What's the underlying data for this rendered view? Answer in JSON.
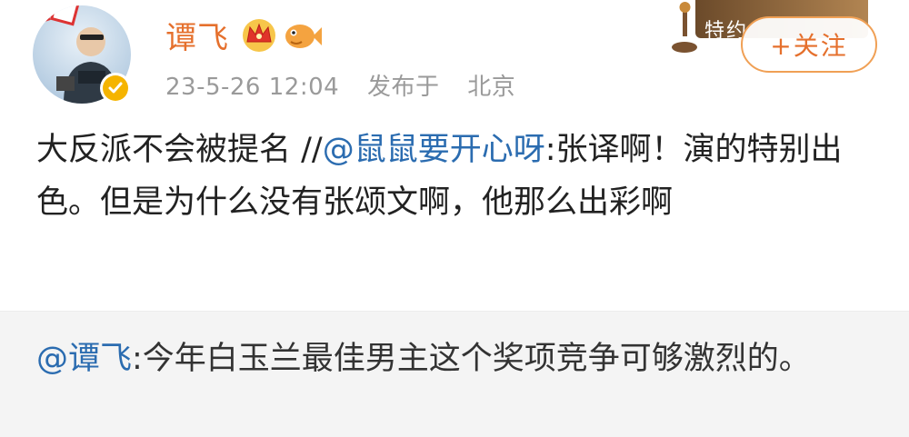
{
  "post": {
    "author": "谭飞",
    "date": "23-5-26 12:04",
    "location_prefix": "发布于",
    "location": "北京",
    "follow_label": "+关注",
    "event_card_label": "特约",
    "content": {
      "text1": "大反派不会被提名 //",
      "mention": "@鼠鼠要开心呀",
      "text2": ":张译啊！演的特别出色。但是为什么没有张颂文啊，他那么出彩啊"
    }
  },
  "repost": {
    "mention": "@谭飞",
    "text": ":今年白玉兰最佳男主这个奖项竞争可够激烈的。"
  },
  "colors": {
    "username": "#e5702d",
    "mention": "#2b6cb0",
    "verified_badge": "#f5b400"
  },
  "icons": {
    "avatar": "user-avatar",
    "verified": "verified-badge-icon",
    "crown": "crown-badge-icon",
    "fish": "fish-badge-icon",
    "trophy": "trophy-icon"
  }
}
